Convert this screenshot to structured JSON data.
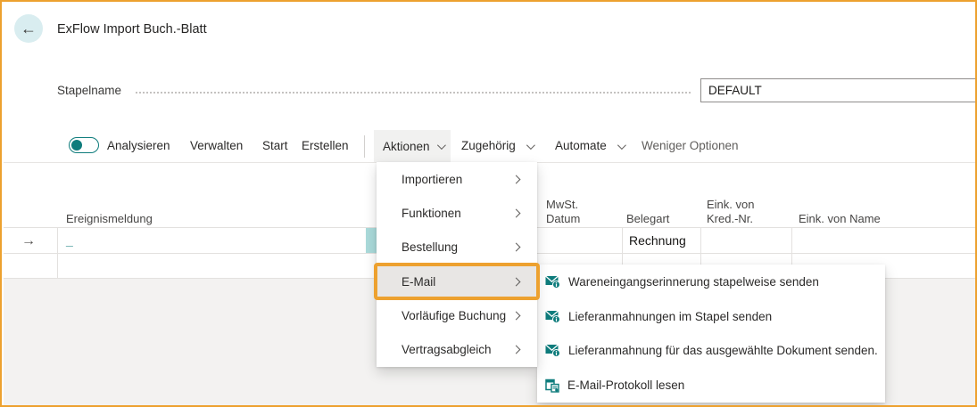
{
  "page": {
    "title": "ExFlow Import Buch.-Blatt"
  },
  "form": {
    "stapelname_label": "Stapelname",
    "stapelname_value": "DEFAULT"
  },
  "toolbar": {
    "analyze_label": "Analysieren",
    "items": [
      "Verwalten",
      "Start",
      "Erstellen"
    ],
    "actions_label": "Aktionen",
    "related_label": "Zugehörig",
    "automate_label": "Automate",
    "more_label": "Weniger Optionen"
  },
  "actions_menu": {
    "items": [
      {
        "label": "Importieren",
        "has_submenu": true
      },
      {
        "label": "Funktionen",
        "has_submenu": true
      },
      {
        "label": "Bestellung",
        "has_submenu": true
      },
      {
        "label": "E-Mail",
        "has_submenu": true,
        "highlighted": true
      },
      {
        "label": "Vorläufige Buchung",
        "has_submenu": true
      },
      {
        "label": "Vertragsabgleich",
        "has_submenu": true
      }
    ]
  },
  "email_submenu": {
    "items": [
      {
        "label": "Wareneingangserinnerung stapelweise senden",
        "icon": "mail-info-icon"
      },
      {
        "label": "Lieferanmahnungen im Stapel senden",
        "icon": "mail-info-icon"
      },
      {
        "label": "Lieferanmahnung für das ausgewählte Dokument senden.",
        "icon": "mail-info-icon"
      },
      {
        "label": "E-Mail-Protokoll lesen",
        "icon": "log-read-icon"
      }
    ]
  },
  "table": {
    "columns": [
      {
        "label": "Ereignismeldung"
      },
      {
        "label": "MwSt. Datum"
      },
      {
        "label": "Belegart"
      },
      {
        "label": "Eink. von Kred.-Nr."
      },
      {
        "label": "Eink. von Name"
      }
    ],
    "rows": [
      {
        "ereignismeldung": "_",
        "belegart": "Rechnung"
      },
      {
        "ereignismeldung": "",
        "belegart": ""
      }
    ]
  },
  "colors": {
    "accent_orange": "#EDA12F",
    "teal": "#0E7C7C",
    "selection_teal": "#ABDBDB",
    "gray_background": "#F3F2F1"
  }
}
